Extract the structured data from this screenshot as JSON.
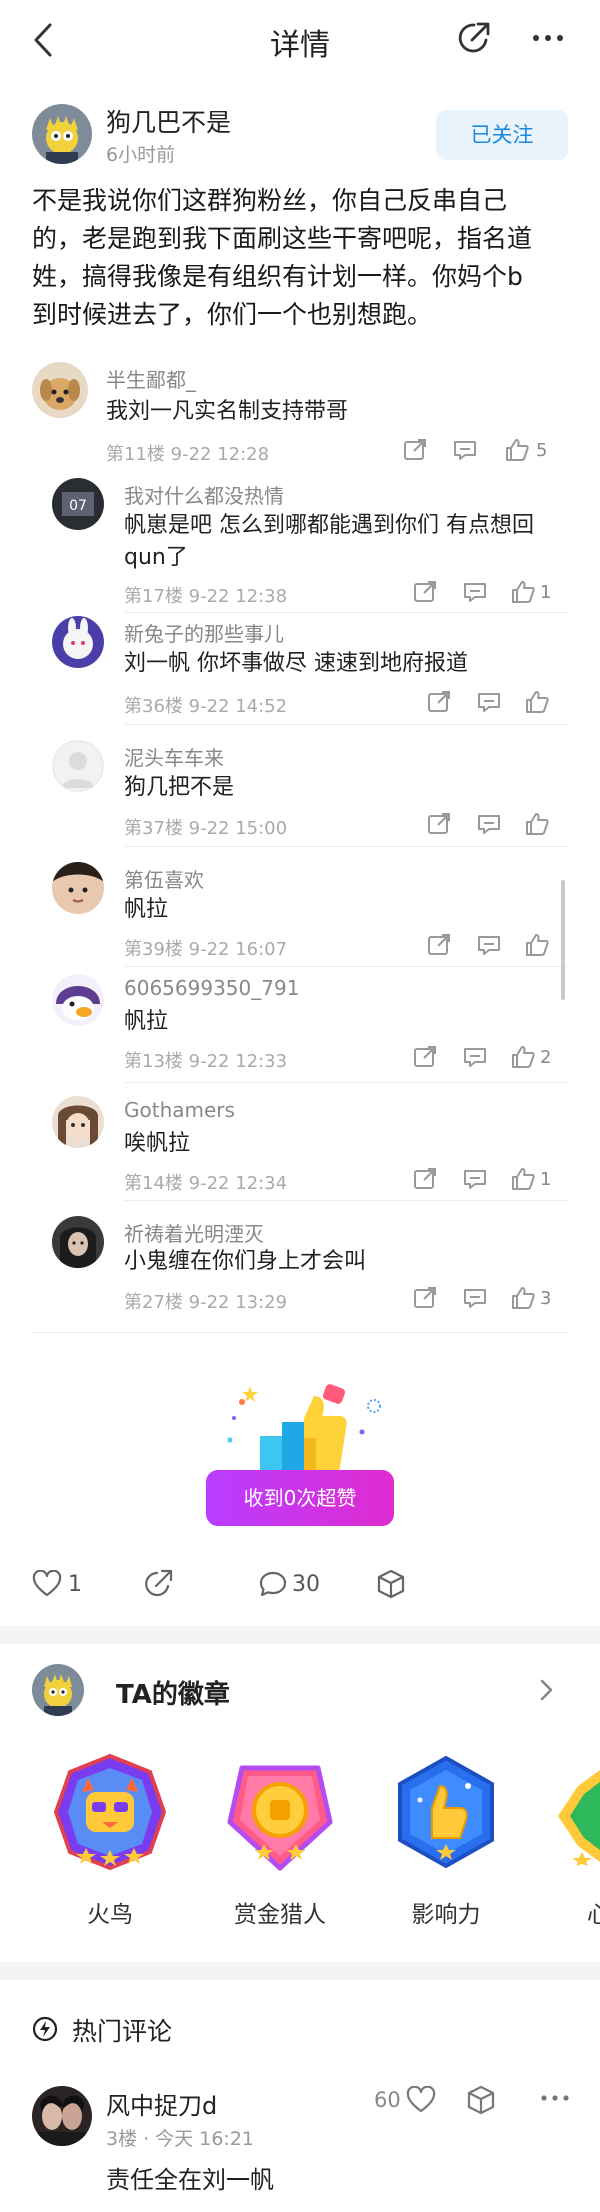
{
  "nav": {
    "title": "详情"
  },
  "author": {
    "name": "狗几巴不是",
    "time": "6小时前",
    "follow_label": "已关注"
  },
  "post": {
    "lines": [
      "不是我说你们这群狗粉丝，你自己反串自己",
      "的，老是跑到我下面刷这些干寄吧呢，指名道",
      "姓，搞得我像是有组织有计划一样。你妈个b",
      "到时候进去了，你们一个也别想跑。"
    ]
  },
  "comments": [
    {
      "name": "半生鄙都_",
      "text": [
        "我刘一凡实名制支持带哥"
      ],
      "meta": "第11楼 9-22 12:28",
      "likes": "5"
    },
    {
      "name": "我对什么都没热情",
      "text": [
        "帆崽是吧 怎么到哪都能遇到你们 有点想回",
        "qun了"
      ],
      "meta": "第17楼 9-22 12:38",
      "likes": "1"
    },
    {
      "name": "新兔子的那些事儿",
      "text": [
        "刘一帆 你坏事做尽 速速到地府报道"
      ],
      "meta": "第36楼 9-22 14:52",
      "likes": ""
    },
    {
      "name": "泥头车车来",
      "text": [
        "狗几把不是"
      ],
      "meta": "第37楼 9-22 15:00",
      "likes": ""
    },
    {
      "name": "第伍喜欢",
      "text": [
        "帆拉"
      ],
      "meta": "第39楼 9-22 16:07",
      "likes": ""
    },
    {
      "name": "6065699350_791",
      "text": [
        "帆拉"
      ],
      "meta": "第13楼 9-22 12:33",
      "likes": "2"
    },
    {
      "name": "Gothamers",
      "text": [
        "唉帆拉"
      ],
      "meta": "第14楼 9-22 12:34",
      "likes": "1"
    },
    {
      "name": "祈祷着光明湮灭",
      "text": [
        "小鬼缠在你们身上才会叫"
      ],
      "meta": "第27楼 9-22 13:29",
      "likes": "3"
    }
  ],
  "superlike": {
    "label": "收到0次超赞"
  },
  "stats": {
    "likes": "1",
    "comments": "30"
  },
  "badges": {
    "title": "TA的徽章",
    "items": [
      {
        "label": "火鸟"
      },
      {
        "label": "赏金猎人"
      },
      {
        "label": "影响力"
      },
      {
        "label": "心"
      }
    ]
  },
  "hot": {
    "title": "热门评论",
    "comment": {
      "name": "风中捉刀d",
      "meta": "3楼 · 今天 16:21",
      "likes": "60",
      "text": "责任全在刘一帆"
    }
  },
  "colors": {
    "accent": "#1b8adc",
    "superlike_start": "#b83dff",
    "superlike_end": "#e02bd0"
  }
}
